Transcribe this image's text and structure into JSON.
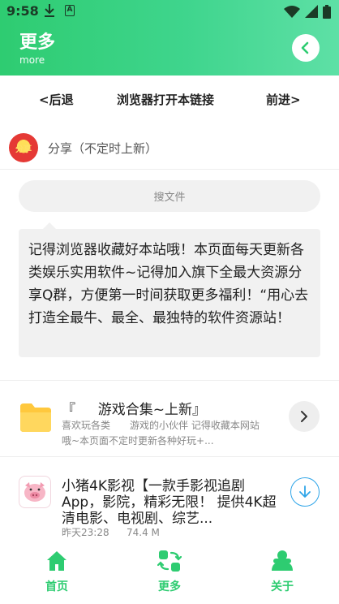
{
  "status": {
    "time": "9:58",
    "notify_a": "A"
  },
  "header": {
    "title": "更多",
    "subtitle": "more"
  },
  "nav": {
    "back": "<后退",
    "open_browser": "浏览器打开本链接",
    "forward": "前进>"
  },
  "share": {
    "logo_text": "分享",
    "label": "分享（不定时上新）"
  },
  "search": {
    "placeholder": "搜文件"
  },
  "notice": {
    "text": "记得浏览器收藏好本站哦！本页面每天更新各类娱乐实用软件~记得加入旗下全最大资源分享Q群，方便第一时间获取更多福利！“用心去打造全最牛、最全、最独特的软件资源站！"
  },
  "items": [
    {
      "title": "『 　 游戏合集~上新』",
      "desc_line1": "喜欢玩各类　　游戏的小伙伴 记得收藏本网站",
      "desc_line2": "哦~本页面不定时更新各种好玩+..."
    },
    {
      "title_line1": "小猪4K影视【一款手影视追剧",
      "title_line2": "App，影院，精彩无限！ 提供4K超",
      "title_line3": "清电影、电视剧、综艺...",
      "date": "昨天23:28",
      "size": "74.4 M"
    }
  ],
  "tabs": [
    {
      "label": "首页",
      "icon": "home-icon"
    },
    {
      "label": "更多",
      "icon": "swap-icon"
    },
    {
      "label": "关于",
      "icon": "person-icon"
    }
  ],
  "colors": {
    "accent": "#2ecc71",
    "download": "#2fa5e8"
  }
}
